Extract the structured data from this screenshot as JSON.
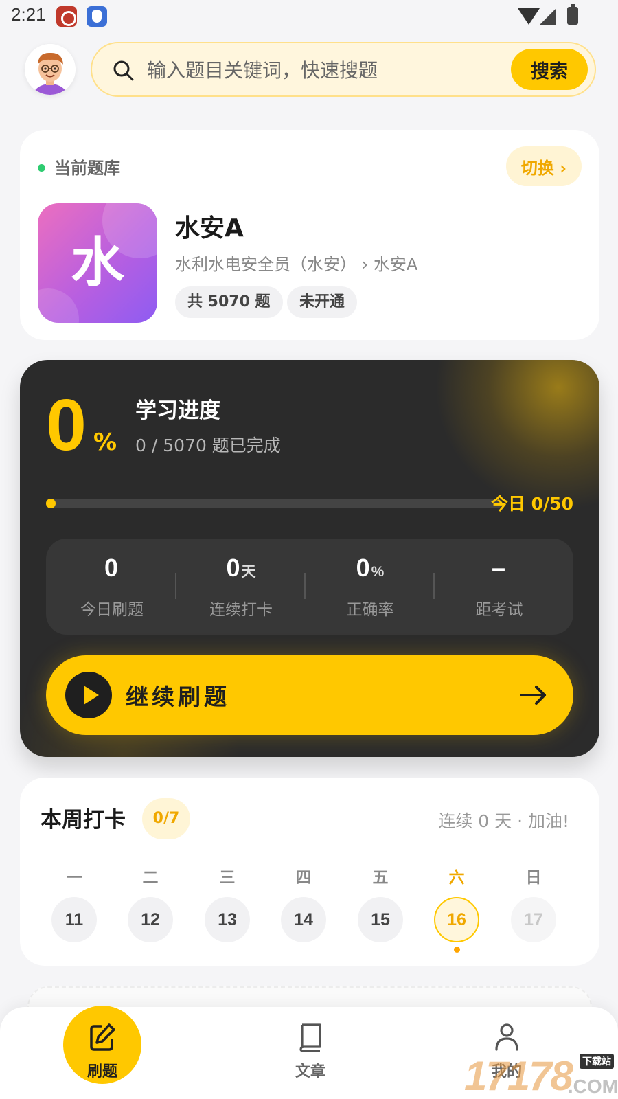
{
  "status_bar": {
    "time": "2:21"
  },
  "header": {
    "search_placeholder": "输入题目关键词，快速搜题",
    "search_button": "搜索"
  },
  "bank": {
    "label": "当前题库",
    "switch_button": "切换 ›",
    "logo_char": "水",
    "name": "水安A",
    "path": "水利水电安全员（水安） › 水安A",
    "total_tag": "共 5070 题",
    "status_tag": "未开通",
    "logo_gradient": [
      "#ec6fbf",
      "#8e5cf2"
    ]
  },
  "progress": {
    "percent_value": "0",
    "percent_sign": "%",
    "title": "学习进度",
    "subtitle": "0 / 5070 题已完成",
    "progress_fraction": 0,
    "today": "今日 0/50",
    "stats": [
      {
        "value": "0",
        "unit": "",
        "label": "今日刷题"
      },
      {
        "value": "0",
        "unit": "天",
        "label": "连续打卡"
      },
      {
        "value": "0",
        "unit": "%",
        "label": "正确率"
      },
      {
        "value": "–",
        "unit": "",
        "label": "距考试"
      }
    ],
    "continue_button": "继续刷题"
  },
  "week": {
    "title": "本周打卡",
    "badge": "0/7",
    "streak": "连续 0 天 · 加油!",
    "days": [
      {
        "name": "一",
        "date": "11",
        "state": "past"
      },
      {
        "name": "二",
        "date": "12",
        "state": "past"
      },
      {
        "name": "三",
        "date": "13",
        "state": "past"
      },
      {
        "name": "四",
        "date": "14",
        "state": "past"
      },
      {
        "name": "五",
        "date": "15",
        "state": "past"
      },
      {
        "name": "六",
        "date": "16",
        "state": "today"
      },
      {
        "name": "日",
        "date": "17",
        "state": "future"
      }
    ]
  },
  "bottom_nav": {
    "items": [
      {
        "label": "刷题",
        "icon": "edit-icon",
        "active": true
      },
      {
        "label": "文章",
        "icon": "book-icon",
        "active": false
      },
      {
        "label": "我的",
        "icon": "person-icon",
        "active": false
      }
    ]
  },
  "watermark": {
    "text": "17178",
    "site": "下载站",
    "suffix": ".COM"
  },
  "colors": {
    "accent": "#ffc800",
    "accent_text": "#f0a800",
    "dark_card": "#2b2b2b",
    "background": "#f5f5f7"
  }
}
